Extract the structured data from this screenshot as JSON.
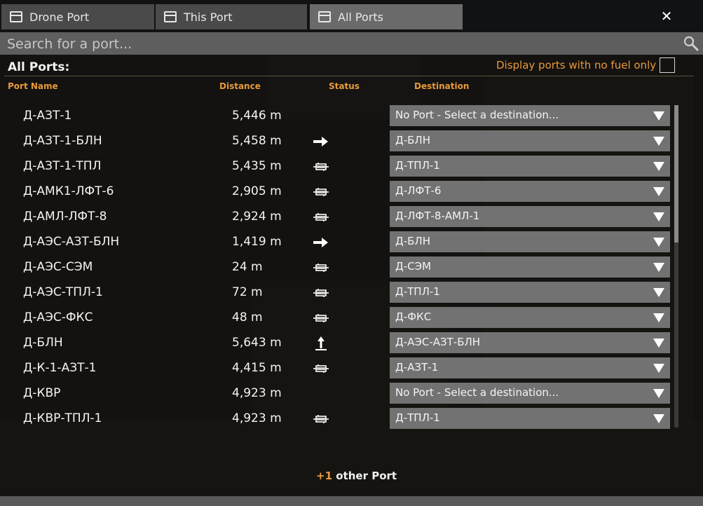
{
  "tabs": [
    {
      "label": "Drone Port",
      "icon": "window-icon",
      "active": false
    },
    {
      "label": "This Port",
      "icon": "window-icon",
      "active": false
    },
    {
      "label": "All Ports",
      "icon": "window-icon",
      "active": true
    }
  ],
  "close_label": "✕",
  "search": {
    "placeholder": "Search for a port...",
    "value": ""
  },
  "panel": {
    "heading": "All Ports:",
    "fuel_filter_label": "Display ports with no fuel only",
    "fuel_filter_checked": false
  },
  "columns": {
    "name": "Port Name",
    "distance": "Distance",
    "status": "Status",
    "destination": "Destination"
  },
  "ports": [
    {
      "name": "Д-АЗТ-1",
      "distance": "5,446 m",
      "status": "none",
      "destination": "No Port - Select a destination..."
    },
    {
      "name": "Д-АЗТ-1-БЛН",
      "distance": "5,458 m",
      "status": "departing",
      "destination": "Д-БЛН"
    },
    {
      "name": "Д-АЗТ-1-ТПЛ",
      "distance": "5,435 m",
      "status": "docked",
      "destination": "Д-ТПЛ-1"
    },
    {
      "name": "Д-АМК1-ЛФТ-6",
      "distance": "2,905 m",
      "status": "docked",
      "destination": "Д-ЛФТ-6"
    },
    {
      "name": "Д-АМЛ-ЛФТ-8",
      "distance": "2,924 m",
      "status": "docked",
      "destination": "Д-ЛФТ-8-АМЛ-1"
    },
    {
      "name": "Д-АЭС-АЗТ-БЛН",
      "distance": "1,419 m",
      "status": "departing",
      "destination": "Д-БЛН"
    },
    {
      "name": "Д-АЭС-СЭМ",
      "distance": "24 m",
      "status": "docked",
      "destination": "Д-СЭМ"
    },
    {
      "name": "Д-АЭС-ТПЛ-1",
      "distance": "72 m",
      "status": "docked",
      "destination": "Д-ТПЛ-1"
    },
    {
      "name": "Д-АЭС-ФКС",
      "distance": "48 m",
      "status": "docked",
      "destination": "Д-ФКС"
    },
    {
      "name": "Д-БЛН",
      "distance": "5,643 m",
      "status": "takeoff",
      "destination": "Д-АЭС-АЗТ-БЛН"
    },
    {
      "name": "Д-К-1-АЗТ-1",
      "distance": "4,415 m",
      "status": "docked",
      "destination": "Д-АЗТ-1"
    },
    {
      "name": "Д-КВР",
      "distance": "4,923 m",
      "status": "none",
      "destination": "No Port - Select a destination..."
    },
    {
      "name": "Д-КВР-ТПЛ-1",
      "distance": "4,923 m",
      "status": "docked",
      "destination": "Д-ТПЛ-1"
    }
  ],
  "more": {
    "count": "+1",
    "label": "other Port"
  },
  "colors": {
    "accent": "#e89a3a",
    "dropdown": "#727272",
    "tab_active": "#6a6a6a",
    "tab_inactive": "#4a4a4a"
  }
}
